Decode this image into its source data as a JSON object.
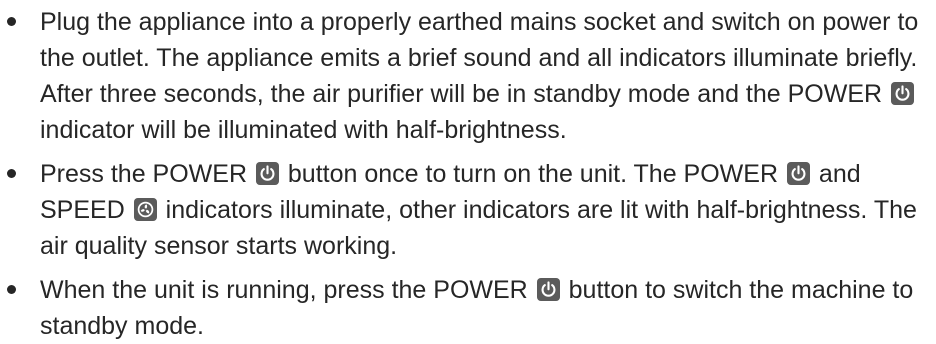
{
  "bullets": [
    {
      "parts": [
        "Plug the appliance into a properly earthed mains socket and switch on power to the outlet. The appliance emits a brief sound and all indicators illuminate briefly. After three seconds, the air purifier will be in standby mode and the POWER",
        "indicator will be illuminated with half-brightness."
      ],
      "icons": [
        "power-icon"
      ]
    },
    {
      "parts": [
        "Press the POWER",
        "button once to turn on the unit. The POWER",
        "and SPEED",
        "indicators illuminate, other indicators are lit with half-brightness. The air quality sensor starts working."
      ],
      "icons": [
        "power-icon",
        "power-icon",
        "fan-speed-icon"
      ]
    },
    {
      "parts": [
        "When the unit is running, press the POWER",
        "button to switch the machine to standby mode."
      ],
      "icons": [
        "power-icon"
      ]
    }
  ],
  "colors": {
    "text": "#262626",
    "icon_background": "#5b5b5b",
    "icon_foreground": "#ffffff"
  }
}
